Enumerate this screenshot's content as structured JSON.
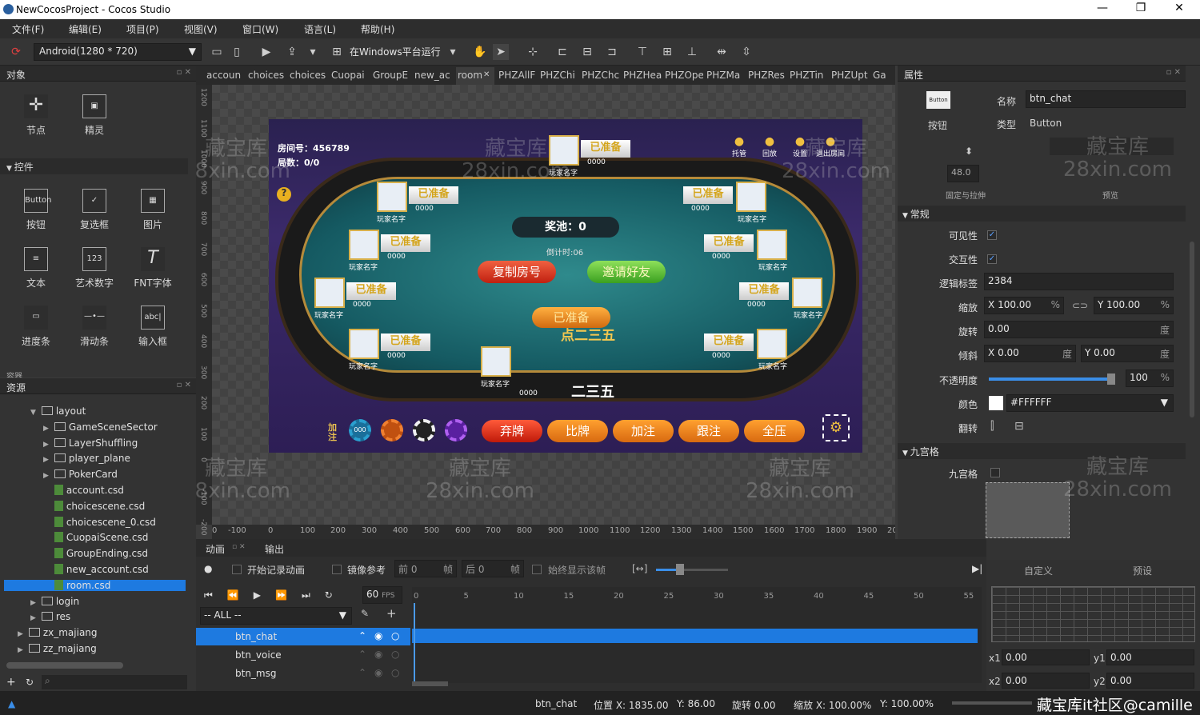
{
  "window": {
    "title": "NewCocosProject - Cocos Studio",
    "min": "—",
    "max": "❐",
    "close": "✕"
  },
  "menu": [
    "文件(F)",
    "编辑(E)",
    "项目(P)",
    "视图(V)",
    "窗口(W)",
    "语言(L)",
    "帮助(H)"
  ],
  "toolbar": {
    "resolution": "Android(1280 * 720)",
    "run_label": "在Windows平台运行"
  },
  "objects_panel": {
    "title": "对象",
    "basic": [
      {
        "label": "节点"
      },
      {
        "label": "精灵"
      }
    ],
    "controls_header": "控件",
    "controls": [
      {
        "label": "按钮",
        "icon": "Button"
      },
      {
        "label": "复选框",
        "icon": "✓"
      },
      {
        "label": "图片",
        "icon": "▦"
      },
      {
        "label": "文本",
        "icon": "≡"
      },
      {
        "label": "艺术数字",
        "icon": "123"
      },
      {
        "label": "FNT字体",
        "icon": "T"
      },
      {
        "label": "进度条",
        "icon": "▭"
      },
      {
        "label": "滑动条",
        "icon": "—•—"
      },
      {
        "label": "输入框",
        "icon": "abc|"
      }
    ],
    "next_header": "容器"
  },
  "assets_panel": {
    "title": "资源",
    "items": [
      {
        "label": "layout",
        "type": "folder",
        "level": 1,
        "open": true
      },
      {
        "label": "GameSceneSector",
        "type": "folder",
        "level": 2
      },
      {
        "label": "LayerShuffling",
        "type": "folder",
        "level": 2
      },
      {
        "label": "player_plane",
        "type": "folder",
        "level": 2
      },
      {
        "label": "PokerCard",
        "type": "folder",
        "level": 2
      },
      {
        "label": "account.csd",
        "type": "file",
        "level": 2
      },
      {
        "label": "choicescene.csd",
        "type": "file",
        "level": 2
      },
      {
        "label": "choicescene_0.csd",
        "type": "file",
        "level": 2
      },
      {
        "label": "CuopaiScene.csd",
        "type": "file",
        "level": 2
      },
      {
        "label": "GroupEnding.csd",
        "type": "file",
        "level": 2
      },
      {
        "label": "new_account.csd",
        "type": "file",
        "level": 2
      },
      {
        "label": "room.csd",
        "type": "file",
        "level": 2,
        "selected": true
      },
      {
        "label": "login",
        "type": "folder",
        "level": 1
      },
      {
        "label": "res",
        "type": "folder",
        "level": 1
      },
      {
        "label": "zx_majiang",
        "type": "folder",
        "level": 0
      },
      {
        "label": "zz_majiang",
        "type": "folder",
        "level": 0
      }
    ]
  },
  "tabs": [
    "accoun",
    "choices",
    "choices",
    "Cuopai",
    "GroupE",
    "new_ac",
    "room",
    "PHZAllF",
    "PHZChi",
    "PHZChc",
    "PHZHea",
    "PHZOpe",
    "PHZMa",
    "PHZRes",
    "PHZTin",
    "PHZUpt",
    "Ga"
  ],
  "active_tab": "room",
  "game": {
    "room_no": "房间号：456789",
    "rounds": "局数：0/0",
    "prize": "奖池：0",
    "countdown": "倒计时:06",
    "copy_btn": "复制房号",
    "invite_btn": "邀请好友",
    "ready_self": "已准备",
    "center_text": "点二三五",
    "logo": "二三五",
    "top_icons": [
      "托管",
      "回放",
      "设置",
      "退出房间"
    ],
    "player_name": "玩家名字",
    "score": "0000",
    "ready": "已准备",
    "add_label": "加注",
    "chip_value": "000",
    "actions": [
      "弃牌",
      "比牌",
      "加注",
      "跟注",
      "全压"
    ]
  },
  "ruler_h": [
    "0",
    "-100",
    "0",
    "100",
    "200",
    "300",
    "400",
    "500",
    "600",
    "700",
    "800",
    "900",
    "1000",
    "1100",
    "1200",
    "1300",
    "1400",
    "1500",
    "1600",
    "1700",
    "1800",
    "1900",
    "2000"
  ],
  "ruler_v": [
    "1200",
    "1100",
    "1000",
    "900",
    "800",
    "700",
    "600",
    "500",
    "400",
    "300",
    "200",
    "100",
    "0",
    "-100",
    "-200"
  ],
  "watermark": {
    "line1": "藏宝库",
    "line2": "28xin.com"
  },
  "props": {
    "title": "属性",
    "preview_icon": "Button",
    "type_icon_label": "按钮",
    "name_label": "名称",
    "name_value": "btn_chat",
    "type_label": "类型",
    "type_value": "Button",
    "anchor_value": "48.0",
    "anchor_caption": "固定与拉伸",
    "preview_caption": "预览",
    "general": "常规",
    "visible": "可见性",
    "interactive": "交互性",
    "tag_label": "逻辑标签",
    "tag_value": "2384",
    "scale_label": "缩放",
    "scale_x": "100.00",
    "scale_y": "100.00",
    "pct": "%",
    "rotate_label": "旋转",
    "rotate_value": "0.00",
    "deg": "度",
    "skew_label": "倾斜",
    "skew_x": "0.00",
    "skew_y": "0.00",
    "opacity_label": "不透明度",
    "opacity_value": "100",
    "opacity": 1.0,
    "color_label": "颜色",
    "color_value": "#FFFFFF",
    "flip_label": "翻转",
    "nine_section": "九宫格",
    "nine_label": "九宫格",
    "x": "X",
    "y": "Y"
  },
  "anim": {
    "tab1": "动画",
    "tab2": "输出",
    "record": "开始记录动画",
    "mirror": "镜像参考",
    "before": "前",
    "before_v": "0",
    "after": "后",
    "after_v": "0",
    "frame": "帧",
    "always_show": "始终显示该帧",
    "fps": "60",
    "fps_label": "FPS",
    "filter": "-- ALL --",
    "ticks": [
      "0",
      "5",
      "10",
      "15",
      "20",
      "25",
      "30",
      "35",
      "40",
      "45",
      "50",
      "55"
    ],
    "nodes": [
      "btn_chat",
      "btn_voice",
      "btn_msg"
    ],
    "custom": "自定义",
    "preset": "预设",
    "x1": "x1",
    "x1v": "0.00",
    "y1": "y1",
    "y1v": "0.00",
    "x2": "x2",
    "x2v": "0.00",
    "y2": "y2",
    "y2v": "0.00"
  },
  "status": {
    "node": "btn_chat",
    "pos": "位置 X: 1835.00",
    "pos_y": "Y: 86.00",
    "rot": "旋转 0.00",
    "scale_x": "缩放 X: 100.00%",
    "scale_y": "Y: 100.00%",
    "credit": "藏宝库it社区@camille"
  }
}
